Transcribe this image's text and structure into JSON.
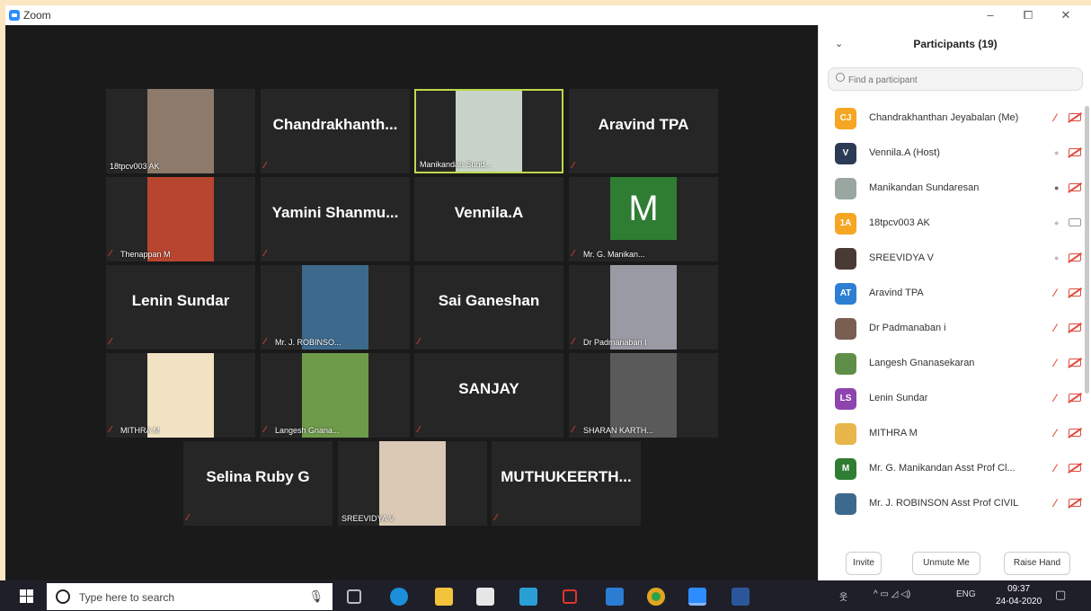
{
  "app": {
    "title": "Zoom",
    "window_controls": [
      "–",
      "⧠",
      "✕"
    ]
  },
  "tiles": [
    {
      "label": "",
      "name": "18tpcv003 AK",
      "type": "photo",
      "muted": false,
      "bg": "#8d7a6a"
    },
    {
      "label": "Chandrakhanth...",
      "name": "",
      "type": "text",
      "muted": true
    },
    {
      "label": "",
      "name": "Manikandan Sund...",
      "type": "photo",
      "muted": false,
      "active": true,
      "bg": "#c8d4c9"
    },
    {
      "label": "Aravind TPA",
      "name": "",
      "type": "text",
      "muted": true
    },
    {
      "label": "",
      "name": "Thenappan M",
      "type": "photo",
      "muted": true,
      "bg": "#b8452f"
    },
    {
      "label": "Yamini  Shanmu...",
      "name": "",
      "type": "text",
      "muted": true
    },
    {
      "label": "Vennila.A",
      "name": "",
      "type": "text",
      "muted": false
    },
    {
      "label": "M",
      "name": "Mr. G. Manikan...",
      "type": "letter",
      "muted": true,
      "bg": "#2f7d33"
    },
    {
      "label": "Lenin Sundar",
      "name": "",
      "type": "text",
      "muted": true
    },
    {
      "label": "",
      "name": "Mr. J. ROBINSO...",
      "type": "photo",
      "muted": true,
      "bg": "#3d6a8c"
    },
    {
      "label": "Sai Ganeshan",
      "name": "",
      "type": "text",
      "muted": true
    },
    {
      "label": "",
      "name": "Dr Padmanaban I",
      "type": "photo",
      "muted": true,
      "bg": "#9a9aa4"
    },
    {
      "label": "",
      "name": "MITHRA M",
      "type": "photo",
      "muted": true,
      "bg": "#f0e2c2"
    },
    {
      "label": "",
      "name": "Langesh Gnana...",
      "type": "photo",
      "muted": true,
      "bg": "#6e9b4a"
    },
    {
      "label": "SANJAY",
      "name": "",
      "type": "text",
      "muted": true
    },
    {
      "label": "",
      "name": "SHARAN KARTH...",
      "type": "photo",
      "muted": true,
      "bg": "#5a5a5a"
    },
    {
      "label": "Selina Ruby G",
      "name": "",
      "type": "text",
      "muted": true
    },
    {
      "label": "",
      "name": "SREEVIDYA V",
      "type": "photo",
      "muted": false,
      "bg": "#d9c9b5"
    },
    {
      "label": "MUTHUKEERTH...",
      "name": "",
      "type": "text",
      "muted": true
    }
  ],
  "participants_panel": {
    "title": "Participants (19)",
    "search_placeholder": "Find a participant",
    "participants": [
      {
        "initials": "CJ",
        "name": "Chandrakhanthan Jeyabalan (Me)",
        "avatar_color": "#f5a623",
        "mic": "muted",
        "cam": "off"
      },
      {
        "initials": "V",
        "name": "Vennila.A (Host)",
        "avatar_color": "#2b3a55",
        "mic": "on",
        "cam": "off"
      },
      {
        "initials": "",
        "name": "Manikandan Sundaresan",
        "avatar_color": "#9aa7a0",
        "mic": "talking",
        "cam": "off"
      },
      {
        "initials": "1A",
        "name": "18tpcv003 AK",
        "avatar_color": "#f5a623",
        "mic": "on",
        "cam": "on"
      },
      {
        "initials": "",
        "name": "SREEVIDYA V",
        "avatar_color": "#4a3a35",
        "mic": "on",
        "cam": "off"
      },
      {
        "initials": "AT",
        "name": "Aravind TPA",
        "avatar_color": "#2d7fd3",
        "mic": "muted",
        "cam": "off"
      },
      {
        "initials": "",
        "name": "Dr Padmanaban i",
        "avatar_color": "#7a5e52",
        "mic": "muted",
        "cam": "off"
      },
      {
        "initials": "",
        "name": "Langesh Gnanasekaran",
        "avatar_color": "#5f8e49",
        "mic": "muted",
        "cam": "off"
      },
      {
        "initials": "LS",
        "name": "Lenin Sundar",
        "avatar_color": "#8e44ad",
        "mic": "muted",
        "cam": "off"
      },
      {
        "initials": "",
        "name": "MITHRA M",
        "avatar_color": "#e8b64a",
        "mic": "muted",
        "cam": "off"
      },
      {
        "initials": "M",
        "name": "Mr. G. Manikandan Asst Prof Cl...",
        "avatar_color": "#2f7d33",
        "mic": "muted",
        "cam": "off"
      },
      {
        "initials": "",
        "name": "Mr. J. ROBINSON Asst Prof CIVIL",
        "avatar_color": "#3d6a8c",
        "mic": "muted",
        "cam": "off"
      }
    ],
    "buttons": [
      "Invite",
      "Unmute Me",
      "Raise Hand"
    ]
  },
  "taskbar": {
    "search_placeholder": "Type here to search",
    "tray_lang": "ENG",
    "time": "09:37",
    "date": "24-04-2020"
  },
  "colors": {
    "accent": "#2d8cff",
    "muted_red": "#e03e2d",
    "active_border": "#bcd94a"
  }
}
